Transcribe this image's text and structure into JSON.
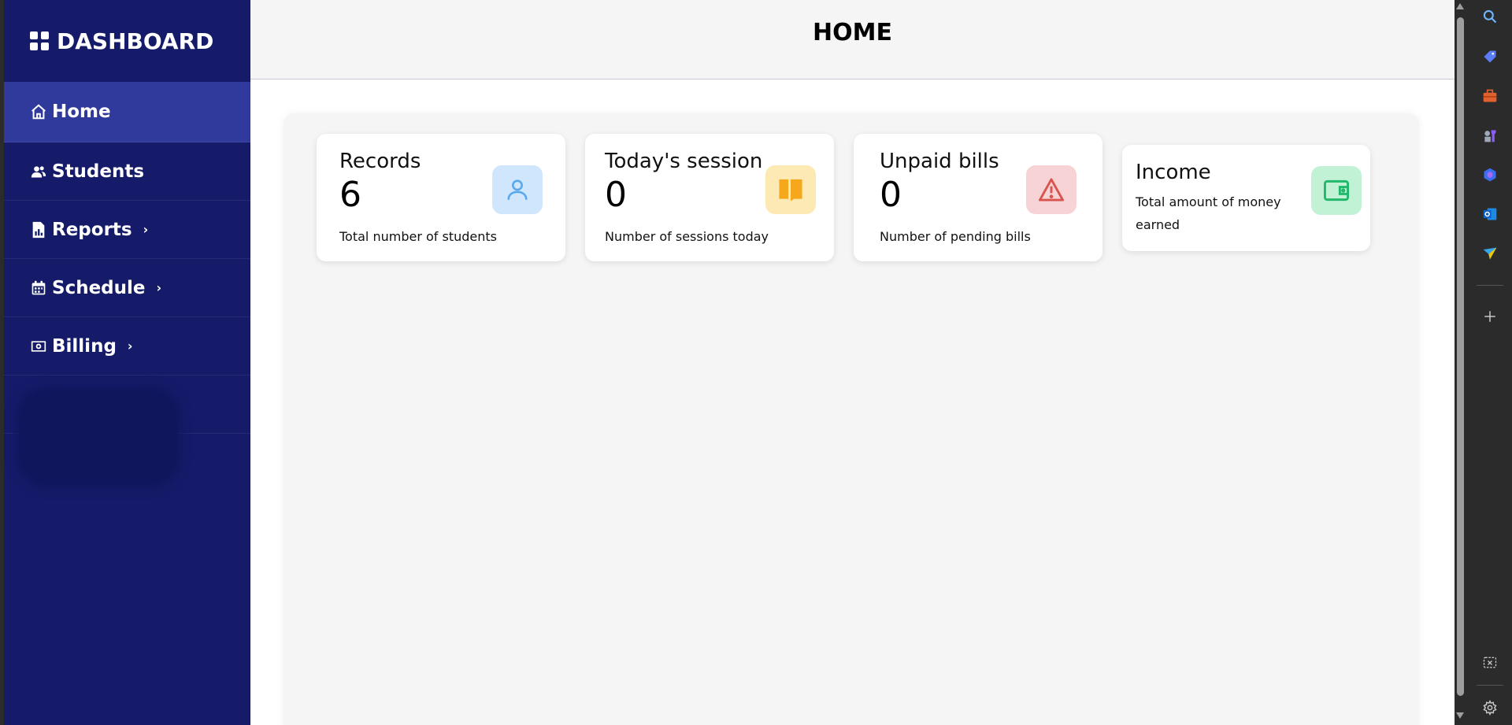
{
  "sidebar": {
    "brand": "DASHBOARD",
    "items": [
      {
        "label": "Home",
        "icon": "home-icon",
        "active": true,
        "has_submenu": false
      },
      {
        "label": "Students",
        "icon": "users-icon",
        "active": false,
        "has_submenu": false
      },
      {
        "label": "Reports",
        "icon": "report-icon",
        "active": false,
        "has_submenu": true
      },
      {
        "label": "Schedule",
        "icon": "calendar-icon",
        "active": false,
        "has_submenu": true
      },
      {
        "label": "Billing",
        "icon": "money-icon",
        "active": false,
        "has_submenu": true
      }
    ],
    "chevron": "›"
  },
  "header": {
    "title": "HOME"
  },
  "cards": [
    {
      "title": "Records",
      "value": "6",
      "description": "Total number of students",
      "icon": "user-icon",
      "color": "#cfe6fd"
    },
    {
      "title": "Today's session",
      "value": "0",
      "description": "Number of sessions today",
      "icon": "book-icon",
      "color": "#fde9b4"
    },
    {
      "title": "Unpaid bills",
      "value": "0",
      "description": "Number of pending bills",
      "icon": "warning-icon",
      "color": "#f7d3d6"
    },
    {
      "title": "Income",
      "value": "",
      "description_line1": "Total amount of money",
      "description_line2": "earned",
      "icon": "wallet-icon",
      "color": "#c2f2d6"
    }
  ],
  "colors": {
    "sidebar": "#151b69",
    "sidebar_active": "#303a9d",
    "panel": "#f5f5f5"
  },
  "edge_sidebar_icons": [
    "search-icon",
    "tag-icon",
    "briefcase-icon",
    "chess-icon",
    "copilot-icon",
    "outlook-icon",
    "send-icon",
    "plus-icon",
    "screenshot-icon",
    "settings-icon"
  ]
}
